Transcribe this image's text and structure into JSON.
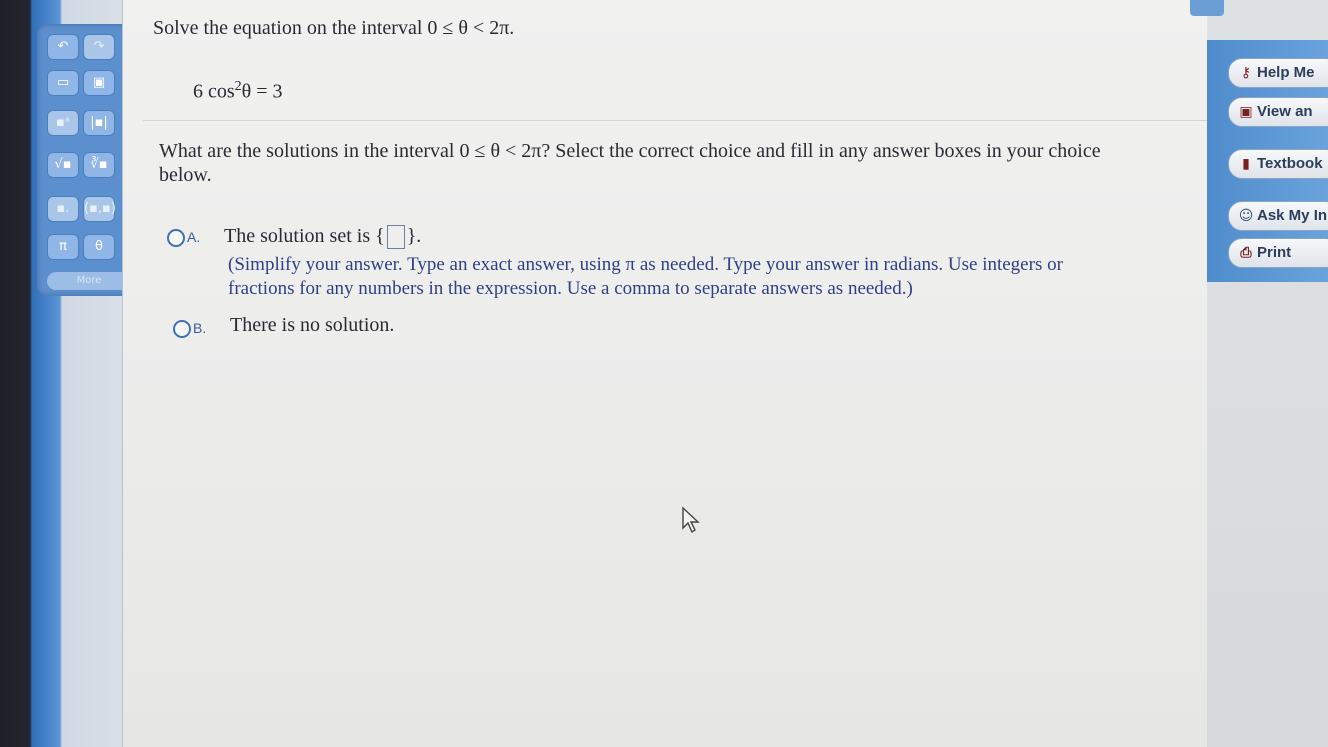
{
  "question": {
    "prompt": "Solve the equation on the interval 0 ≤ θ < 2π.",
    "equation_left": "6 cos",
    "equation_exponent": "2",
    "equation_right": "θ = 3",
    "instruction_line1": "What are the solutions in the interval 0 ≤ θ < 2π?  Select the correct choice and fill in any answer boxes in your choice",
    "instruction_line2": "below."
  },
  "choices": [
    {
      "letter": "A.",
      "text_before": "The solution set is {",
      "text_after": "}.",
      "hint_line1": "(Simplify your answer.  Type an exact answer, using π as needed.  Type your answer in radians.  Use integers or",
      "hint_line2": "fractions for any numbers in the expression.  Use a comma to separate answers as needed.)"
    },
    {
      "letter": "B.",
      "text": "There is no solution."
    }
  ],
  "palette": {
    "buttons": [
      "↶",
      "↷",
      "▭",
      "▣",
      "▪ᵃ",
      "|▪|",
      "√▪",
      "∛▪",
      "▪.",
      "(▪,▪)",
      "π",
      "θ"
    ],
    "more_label": "More"
  },
  "tools": {
    "help_me": "Help Me",
    "view_an": "View an",
    "textbook": "Textbook",
    "ask_my_instructor": "Ask My In",
    "print": "Print"
  }
}
